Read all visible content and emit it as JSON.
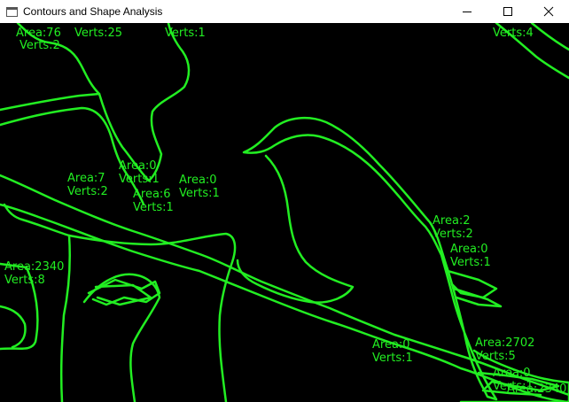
{
  "window": {
    "title": "Contours and Shape Analysis",
    "icons": {
      "app": "app-window-icon",
      "minimize": "minimize-icon",
      "maximize": "maximize-icon",
      "close": "close-icon"
    }
  },
  "colors": {
    "contour": "#22ee22",
    "canvas_bg": "#000000"
  },
  "labels": [
    {
      "area": "Area:76",
      "verts": "Verts:25"
    },
    {
      "area": "",
      "verts": "Verts:1"
    },
    {
      "area": "",
      "verts": "Verts:2"
    },
    {
      "area": "",
      "verts": "Verts:4"
    },
    {
      "area": "Area:0",
      "verts": "Verts:1"
    },
    {
      "area": "Area:0",
      "verts": "Verts:1"
    },
    {
      "area": "Area:7",
      "verts": "Verts:2"
    },
    {
      "area": "Area:6",
      "verts": "Verts:1"
    },
    {
      "area": "Area:2",
      "verts": "Verts:2"
    },
    {
      "area": "Area:0",
      "verts": "Verts:1"
    },
    {
      "area": "Area:2340",
      "verts": "Verts:8"
    },
    {
      "area": "Area:0",
      "verts": "Verts:1"
    },
    {
      "area": "Area:2702",
      "verts": "Verts:5"
    },
    {
      "area": "Area:0",
      "verts": "Verts:1"
    },
    {
      "area": "Area:2340",
      "verts": ""
    }
  ]
}
